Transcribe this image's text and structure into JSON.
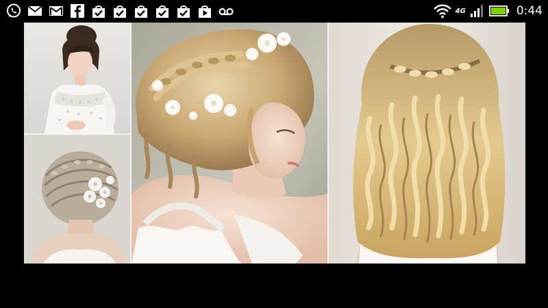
{
  "status_bar": {
    "time": "0:44",
    "network_label": "4G",
    "notification_icons": [
      "whatsapp-icon",
      "mail-icon",
      "gmail-icon",
      "facebook-icon",
      "shopping-bag-icon",
      "shopping-bag-icon",
      "shopping-bag-icon",
      "shopping-bag-icon",
      "shopping-bag-icon",
      "play-store-icon",
      "voicemail-icon"
    ],
    "system_icons": [
      "wifi-icon",
      "signal-icon",
      "battery-icon"
    ],
    "colors": {
      "background": "#000000",
      "foreground": "#ffffff",
      "battery_fill": "#7cd000"
    }
  },
  "collage": {
    "photos": [
      {
        "id": "photo-tl",
        "subject": "bride-with-bangs-updo-lace-dress"
      },
      {
        "id": "photo-bl",
        "subject": "braided-updo-with-lace-hairpiece"
      },
      {
        "id": "photo-center",
        "subject": "blonde-braided-crown-with-flowers"
      },
      {
        "id": "photo-right",
        "subject": "waterfall-braid-loose-curls"
      }
    ]
  }
}
